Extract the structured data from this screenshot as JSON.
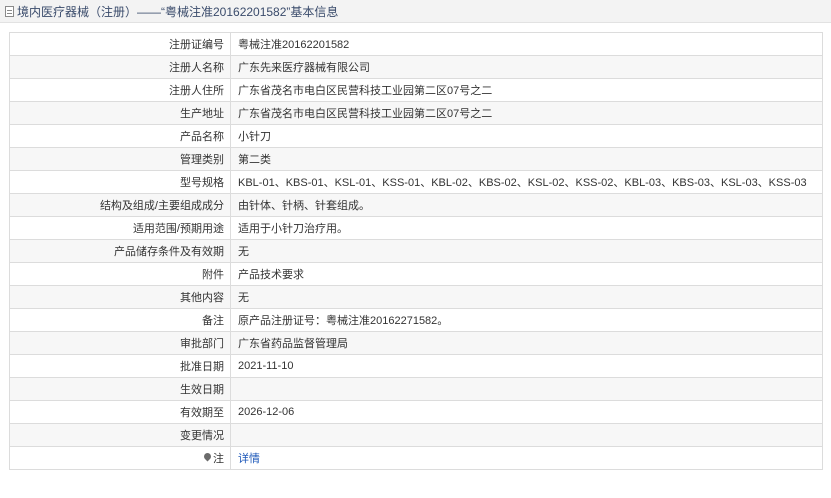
{
  "header": {
    "title": "境内医疗器械（注册）——“粤械注准20162201582”基本信息"
  },
  "rows": [
    {
      "label": "注册证编号",
      "value": "粤械注准20162201582"
    },
    {
      "label": "注册人名称",
      "value": "广东先来医疗器械有限公司"
    },
    {
      "label": "注册人住所",
      "value": "广东省茂名市电白区民营科技工业园第二区07号之二"
    },
    {
      "label": "生产地址",
      "value": "广东省茂名市电白区民营科技工业园第二区07号之二"
    },
    {
      "label": "产品名称",
      "value": "小针刀"
    },
    {
      "label": "管理类别",
      "value": "第二类"
    },
    {
      "label": "型号规格",
      "value": "KBL-01、KBS-01、KSL-01、KSS-01、KBL-02、KBS-02、KSL-02、KSS-02、KBL-03、KBS-03、KSL-03、KSS-03"
    },
    {
      "label": "结构及组成/主要组成成分",
      "value": "由针体、针柄、针套组成。"
    },
    {
      "label": "适用范围/预期用途",
      "value": "适用于小针刀治疗用。"
    },
    {
      "label": "产品储存条件及有效期",
      "value": "无"
    },
    {
      "label": "附件",
      "value": "产品技术要求"
    },
    {
      "label": "其他内容",
      "value": "无"
    },
    {
      "label": "备注",
      "value": "原产品注册证号：粤械注准20162271582。"
    },
    {
      "label": "审批部门",
      "value": "广东省药品监督管理局"
    },
    {
      "label": "批准日期",
      "value": "2021-11-10"
    },
    {
      "label": "生效日期",
      "value": ""
    },
    {
      "label": "有效期至",
      "value": "2026-12-06"
    },
    {
      "label": "变更情况",
      "value": ""
    },
    {
      "label": "注",
      "value": "详情"
    }
  ],
  "icons": {
    "title_icon": "document-icon",
    "note_icon": "pin-icon"
  },
  "colors": {
    "link": "#1a56b8",
    "header_text": "#3a4b6b"
  }
}
